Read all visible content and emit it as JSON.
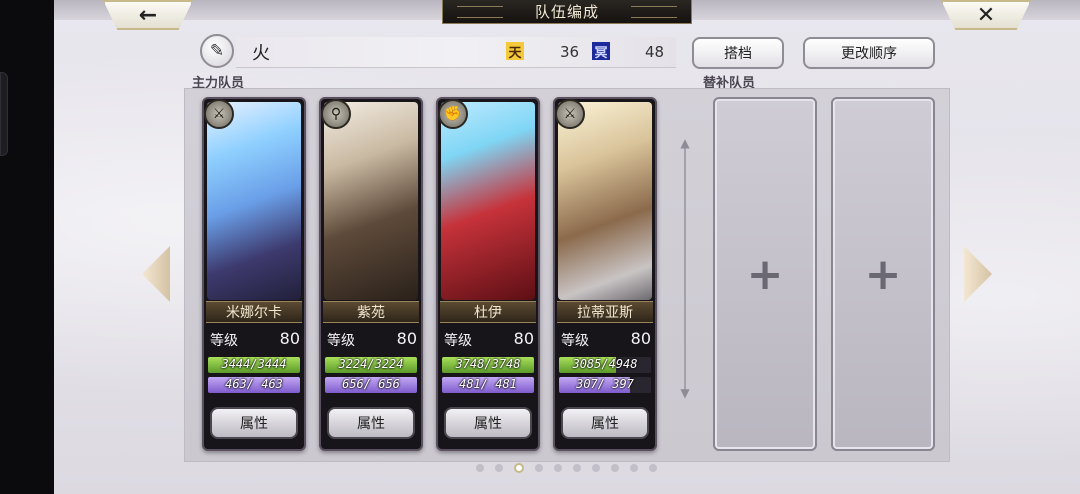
{
  "header": {
    "title": "队伍编成",
    "back_icon": "←",
    "close_icon": "✕"
  },
  "party": {
    "edit_icon": "✎",
    "name": "火",
    "heaven": {
      "icon_text": "天",
      "value": "36",
      "color": "#f4c93a"
    },
    "underworld": {
      "icon_text": "冥",
      "value": "48",
      "color": "#1c2a9b"
    }
  },
  "buttons": {
    "partner_label": "搭档",
    "order_label": "更改顺序"
  },
  "sections": {
    "main_label": "主力队员",
    "sub_label": "替补队员"
  },
  "members": [
    {
      "name": "米娜尔卡",
      "level_label": "等级",
      "level": "80",
      "hp_text": "3444/3444",
      "hp_ratio": 1.0,
      "mp_text": "463/ 463",
      "mp_ratio": 1.0,
      "attr_label": "属性",
      "class_icon": "sword-class-icon"
    },
    {
      "name": "紫苑",
      "level_label": "等级",
      "level": "80",
      "hp_text": "3224/3224",
      "hp_ratio": 1.0,
      "mp_text": "656/ 656",
      "mp_ratio": 1.0,
      "attr_label": "属性",
      "class_icon": "lance-class-icon"
    },
    {
      "name": "杜伊",
      "level_label": "等级",
      "level": "80",
      "hp_text": "3748/3748",
      "hp_ratio": 1.0,
      "mp_text": "481/ 481",
      "mp_ratio": 1.0,
      "attr_label": "属性",
      "class_icon": "fist-class-icon"
    },
    {
      "name": "拉蒂亚斯",
      "level_label": "等级",
      "level": "80",
      "hp_text": "3085/4948",
      "hp_ratio": 0.623,
      "mp_text": "307/ 397",
      "mp_ratio": 0.773,
      "attr_label": "属性",
      "class_icon": "sword-class-icon"
    }
  ],
  "substitutes": [
    {
      "plus": "+"
    },
    {
      "plus": "+"
    }
  ],
  "pagination": {
    "count": 10,
    "active_index": 2
  }
}
